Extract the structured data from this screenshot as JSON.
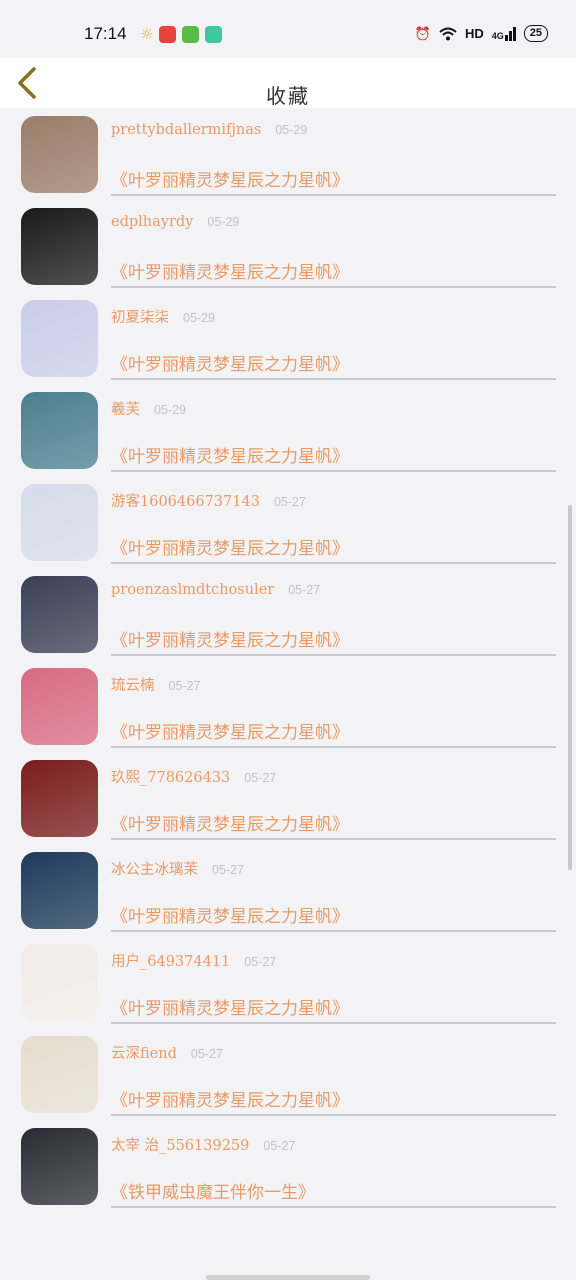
{
  "status_bar": {
    "time": "17:14",
    "network": "HD",
    "signal": "4G",
    "battery": "25"
  },
  "header": {
    "title": "收藏",
    "back_icon": "chevron-left-icon"
  },
  "items": [
    {
      "user": "",
      "date": "",
      "title": "《叶罗丽精灵梦星辰之力星帆》",
      "avatar_color": "#e8cfcf"
    },
    {
      "user": "prettybdallermifjnas",
      "date": "05-29",
      "title": "《叶罗丽精灵梦星辰之力星帆》",
      "avatar_color": "#9a7d6a"
    },
    {
      "user": "edplhayrdy",
      "date": "05-29",
      "title": "《叶罗丽精灵梦星辰之力星帆》",
      "avatar_color": "#1a1a1a"
    },
    {
      "user": "初夏柒柒",
      "date": "05-29",
      "title": "《叶罗丽精灵梦星辰之力星帆》",
      "avatar_color": "#c9cde8"
    },
    {
      "user": "羲芙",
      "date": "05-29",
      "title": "《叶罗丽精灵梦星辰之力星帆》",
      "avatar_color": "#4c7f8f"
    },
    {
      "user": "游客1606466737143",
      "date": "05-27",
      "title": "《叶罗丽精灵梦星辰之力星帆》",
      "avatar_color": "#d5dbe8"
    },
    {
      "user": "proenzaslmdtchosuler",
      "date": "05-27",
      "title": "《叶罗丽精灵梦星辰之力星帆》",
      "avatar_color": "#3a3f55"
    },
    {
      "user": "琉云楠",
      "date": "05-27",
      "title": "《叶罗丽精灵梦星辰之力星帆》",
      "avatar_color": "#d86b83"
    },
    {
      "user": "玖熙_778626433",
      "date": "05-27",
      "title": "《叶罗丽精灵梦星辰之力星帆》",
      "avatar_color": "#7a1c1c"
    },
    {
      "user": "冰公主冰璃茉",
      "date": "05-27",
      "title": "《叶罗丽精灵梦星辰之力星帆》",
      "avatar_color": "#1e3a5a"
    },
    {
      "user": "用户_649374411",
      "date": "05-27",
      "title": "《叶罗丽精灵梦星辰之力星帆》",
      "avatar_color": "#f1ece8"
    },
    {
      "user": "云深fiend",
      "date": "05-27",
      "title": "《叶罗丽精灵梦星辰之力星帆》",
      "avatar_color": "#e6ddd0"
    },
    {
      "user": "太宰 治_556139259",
      "date": "05-27",
      "title": "《铁甲威虫魔王伴你一生》",
      "avatar_color": "#2b2b35"
    }
  ]
}
